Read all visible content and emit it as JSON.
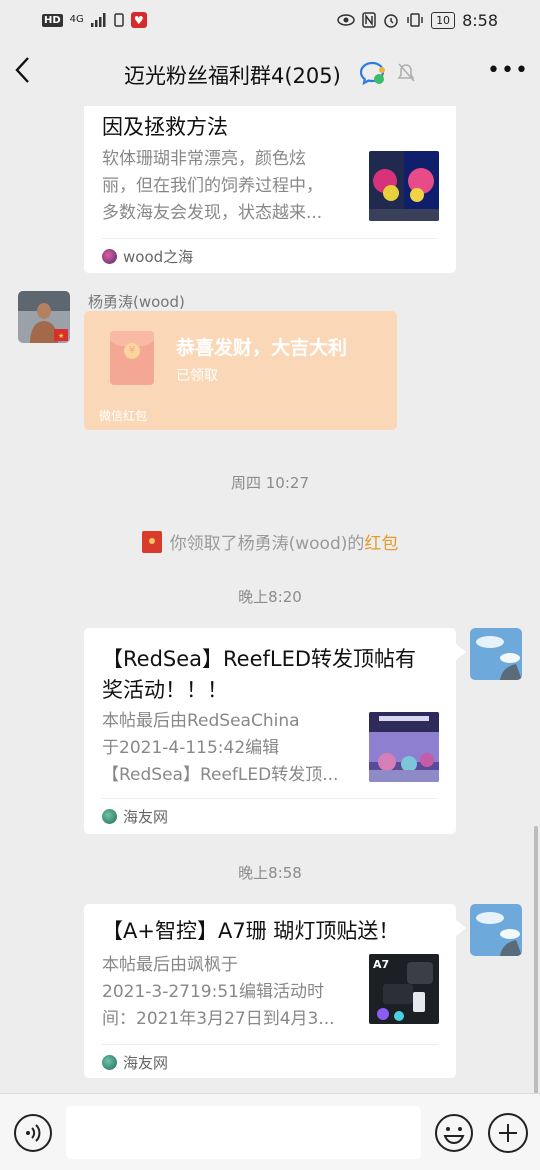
{
  "status_bar": {
    "hd_label": "HD",
    "network": "4G",
    "time": "8:58",
    "battery": "10"
  },
  "header": {
    "back_icon": "chevron-left-icon",
    "title": "迈光粉丝福利群4(205)",
    "more_icon": "more-dots-icon"
  },
  "messages": {
    "card1": {
      "title_line": "因及拯救方法",
      "desc_lines": [
        "软体珊瑚非常漂亮，颜色炫",
        "丽，但在我们的饲养过程中，",
        "多数海友会发现，状态越来..."
      ],
      "source": "wood之海"
    },
    "redpacket_msg": {
      "sender": "杨勇涛(wood)",
      "greeting": "恭喜发财，大吉大利",
      "status": "已领取",
      "footer": "微信红包"
    },
    "time1": "周四 10:27",
    "system1": {
      "prefix": "你领取了杨勇涛(wood)的",
      "link": "红包"
    },
    "time2": "晚上8:20",
    "card2": {
      "title_lines": [
        "【RedSea】ReefLED转发顶帖有",
        "奖活动！！！"
      ],
      "desc_lines": [
        "本帖最后由RedSeaChina",
        "于2021-4-115:42编辑",
        "【RedSea】ReefLED转发顶..."
      ],
      "source": "海友网"
    },
    "time3": "晚上8:58",
    "card3": {
      "title_line": "【A+智控】A7珊 瑚灯顶贴送！",
      "desc_lines": [
        "本帖最后由飒枫于",
        "2021-3-2719:51编辑活动时",
        "间：2021年3月27日到4月3..."
      ],
      "thumb_label": "A7",
      "source": "海友网"
    }
  },
  "input_bar": {
    "voice_icon": "voice-icon",
    "input_value": "",
    "emoji_icon": "emoji-icon",
    "plus_icon": "plus-icon"
  }
}
